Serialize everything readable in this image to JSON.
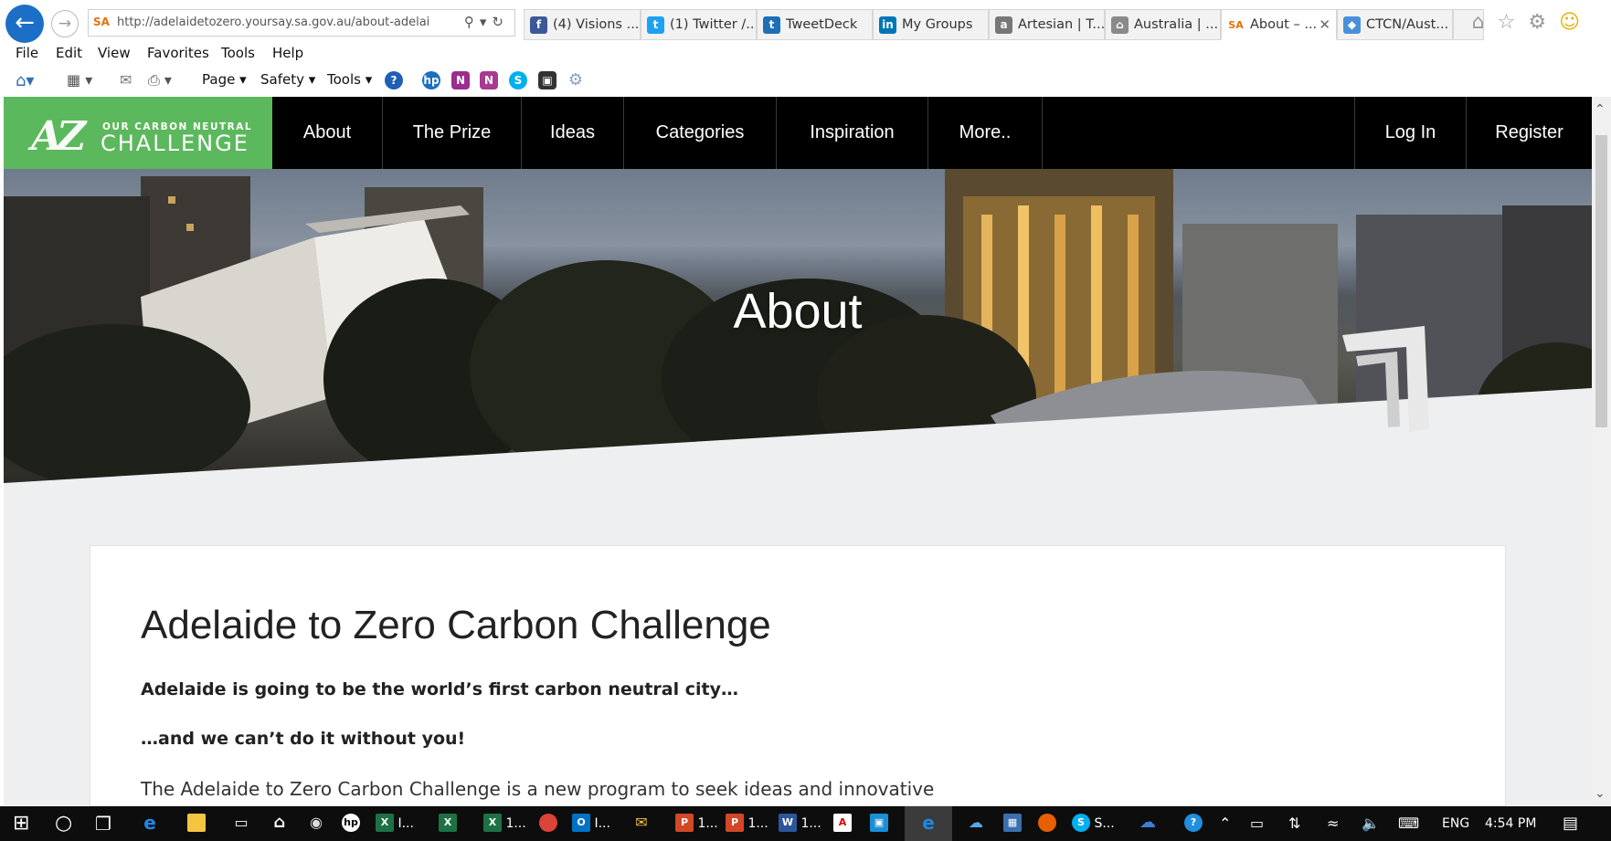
{
  "browser": {
    "url": "http://adelaidetozero.yoursay.sa.gov.au/about-adelai",
    "url_favicon": "SA",
    "tabs": [
      {
        "label": "(4) Visions ...",
        "icon": "facebook-icon",
        "color": "#3b5998",
        "glyph": "f"
      },
      {
        "label": "(1) Twitter /...",
        "icon": "twitter-icon",
        "color": "#1da1f2",
        "glyph": "t"
      },
      {
        "label": "TweetDeck",
        "icon": "tweetdeck-icon",
        "color": "#1d6fb8",
        "glyph": "t"
      },
      {
        "label": "My Groups",
        "icon": "linkedin-icon",
        "color": "#0077b5",
        "glyph": "in"
      },
      {
        "label": "Artesian | T...",
        "icon": "artesian-icon",
        "color": "#777777",
        "glyph": "a"
      },
      {
        "label": "Australia | ...",
        "icon": "institution-icon",
        "color": "#8a8a8a",
        "glyph": "m"
      },
      {
        "label": "About – ...",
        "icon": "sa-icon",
        "color": "#e3730f",
        "glyph": "SA"
      },
      {
        "label": "CTCN/Aust...",
        "icon": "ctcn-icon",
        "color": "#4a90d9",
        "glyph": "c"
      }
    ],
    "menu": [
      "File",
      "Edit",
      "View",
      "Favorites",
      "Tools",
      "Help"
    ],
    "commands": {
      "page": "Page ▾",
      "safety": "Safety ▾",
      "tools": "Tools ▾"
    }
  },
  "site": {
    "logo": {
      "mark": "AZ",
      "line1": "OUR CARBON NEUTRAL",
      "line2": "CHALLENGE"
    },
    "nav": [
      "About",
      "The Prize",
      "Ideas",
      "Categories",
      "Inspiration",
      "More.."
    ],
    "nav_right": [
      "Log In",
      "Register"
    ],
    "hero_title": "About",
    "brand_color": "#5cb85c"
  },
  "content": {
    "title": "Adelaide to Zero Carbon Challenge",
    "lead1": "Adelaide is going to be the world’s first carbon neutral city…",
    "lead2": "…and we can’t do it without you!",
    "body": "The Adelaide to Zero Carbon Challenge is a new program to seek ideas and innovative"
  },
  "taskbar": {
    "items": [
      {
        "label": "",
        "icon": "start-icon"
      },
      {
        "label": "",
        "icon": "cortana-icon"
      },
      {
        "label": "",
        "icon": "task-view-icon"
      },
      {
        "label": "",
        "icon": "edge-icon"
      },
      {
        "label": "",
        "icon": "file-explorer-icon"
      },
      {
        "label": "",
        "icon": "store-icon"
      },
      {
        "label": "",
        "icon": "home-icon"
      },
      {
        "label": "",
        "icon": "camera-icon"
      },
      {
        "label": "",
        "icon": "hp-icon"
      },
      {
        "label": "I...",
        "icon": "excel-icon"
      },
      {
        "label": "",
        "icon": "excel-icon"
      },
      {
        "label": "1...",
        "icon": "excel-icon"
      },
      {
        "label": "",
        "icon": "chrome-icon"
      },
      {
        "label": "I...",
        "icon": "outlook-icon"
      },
      {
        "label": "",
        "icon": "mail-icon"
      },
      {
        "label": "1...",
        "icon": "powerpoint-icon"
      },
      {
        "label": "1...",
        "icon": "powerpoint-icon"
      },
      {
        "label": "1...",
        "icon": "word-icon"
      },
      {
        "label": "",
        "icon": "pdf-icon"
      },
      {
        "label": "",
        "icon": "image-icon"
      },
      {
        "label": "",
        "icon": "ie-icon"
      },
      {
        "label": "",
        "icon": "onedrive-icon"
      },
      {
        "label": "",
        "icon": "app-icon"
      },
      {
        "label": "",
        "icon": "firefox-icon"
      },
      {
        "label": "S...",
        "icon": "skype-icon"
      },
      {
        "label": "",
        "icon": "cloud-icon"
      }
    ],
    "tray": {
      "lang": "ENG",
      "time": "4:54 PM"
    }
  }
}
